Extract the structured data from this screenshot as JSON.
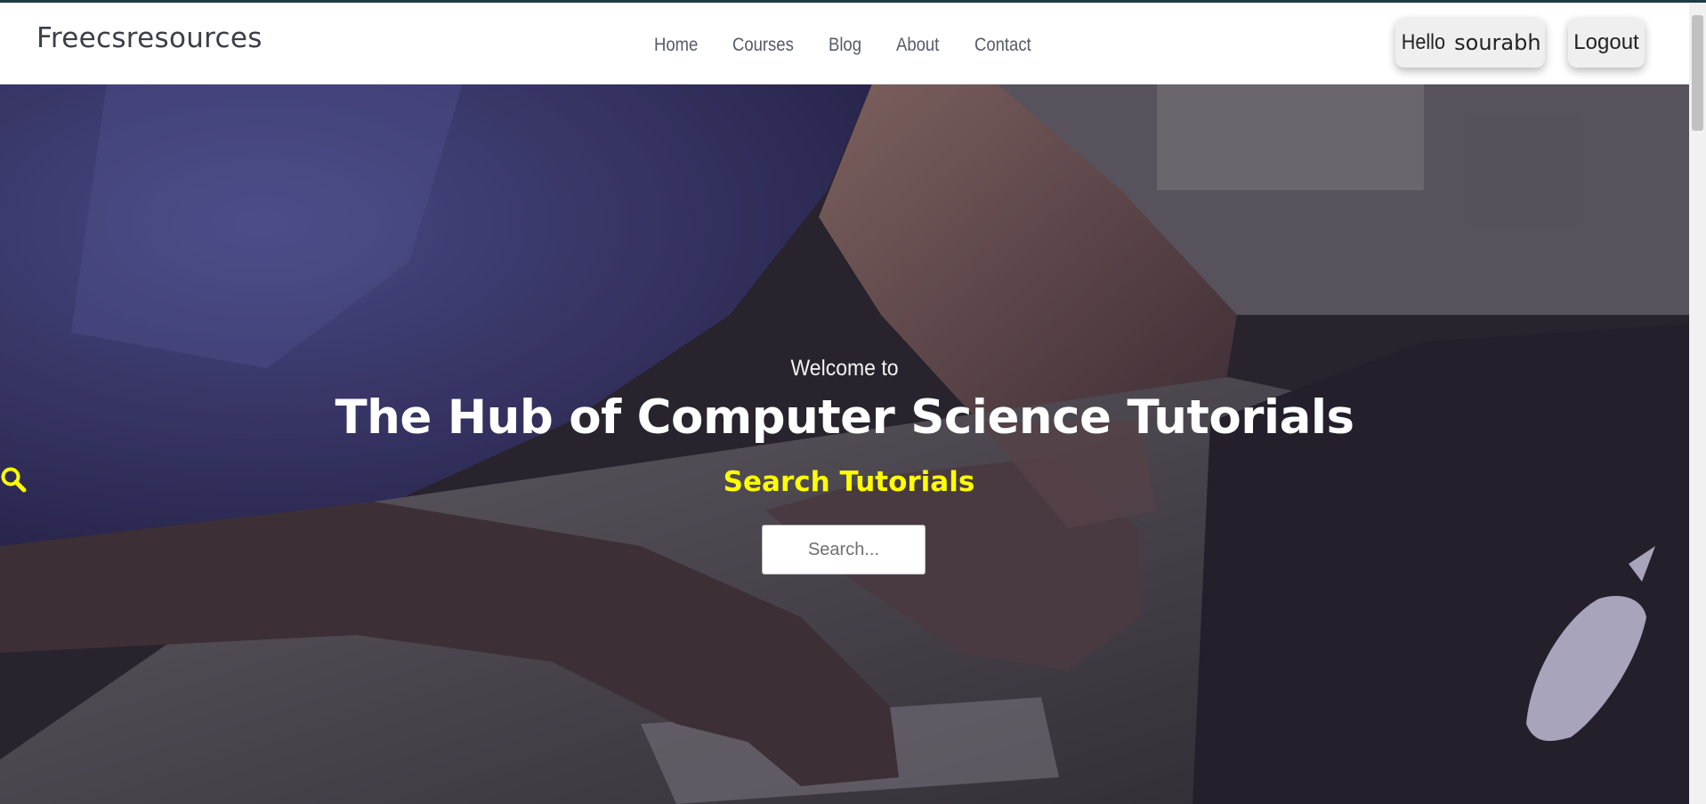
{
  "brand": {
    "name": "Freecsresources"
  },
  "nav": {
    "links": [
      {
        "label": "Home"
      },
      {
        "label": "Courses"
      },
      {
        "label": "Blog"
      },
      {
        "label": "About"
      },
      {
        "label": "Contact"
      }
    ]
  },
  "user": {
    "greeting": "Hello",
    "username": "sourabh",
    "logout_label": "Logout"
  },
  "hero": {
    "welcome": "Welcome to",
    "headline": "The Hub of Computer Science Tutorials",
    "search_title": "Search Tutorials",
    "search_icon": "search-icon",
    "search_placeholder": "Search..."
  },
  "colors": {
    "accent_yellow": "#ffff00",
    "navbar_bg": "#ffffff",
    "text_dark": "#3a3f48"
  }
}
